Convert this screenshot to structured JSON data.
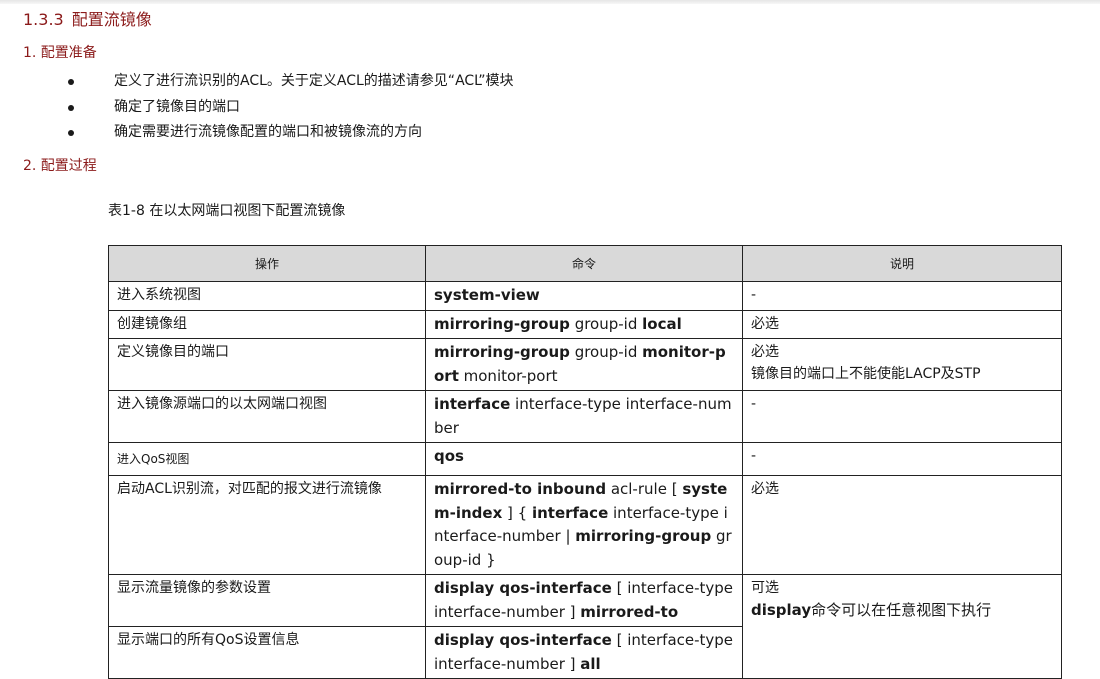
{
  "section": {
    "number": "1.3.3",
    "title": "配置流镜像"
  },
  "prep": {
    "heading": "1. 配置准备",
    "items": [
      "定义了进行流识别的ACL。关于定义ACL的描述请参见“ACL”模块",
      "确定了镜像目的端口",
      "确定需要进行流镜像配置的端口和被镜像流的方向"
    ]
  },
  "process": {
    "heading": "2. 配置过程"
  },
  "table": {
    "caption": "表1-8 在以太网端口视图下配置流镜像",
    "headers": [
      "操作",
      "命令",
      "说明"
    ],
    "rows": [
      {
        "op": "进入系统视图",
        "cmd": [
          {
            "t": "system-view",
            "b": true
          }
        ],
        "note": [
          [
            {
              "t": "-"
            }
          ]
        ]
      },
      {
        "op": "创建镜像组",
        "cmd": [
          {
            "t": "mirroring-group",
            "b": true
          },
          {
            "t": " group-id "
          },
          {
            "t": "local",
            "b": true
          }
        ],
        "note": [
          [
            {
              "t": "必选"
            }
          ]
        ]
      },
      {
        "op": "定义镜像目的端口",
        "cmd": [
          {
            "t": "mirroring-group",
            "b": true
          },
          {
            "t": " group-id "
          },
          {
            "t": "monitor-port",
            "b": true
          },
          {
            "t": " monitor-port"
          }
        ],
        "note": [
          [
            {
              "t": "必选"
            }
          ],
          [
            {
              "t": "镜像目的端口上不能使能LACP及STP"
            }
          ]
        ]
      },
      {
        "op": "进入镜像源端口的以太网端口视图",
        "cmd": [
          {
            "t": "interface",
            "b": true
          },
          {
            "t": " interface-type interface-number"
          }
        ],
        "note": [
          [
            {
              "t": "-"
            }
          ]
        ]
      },
      {
        "op": "进入QoS视图",
        "cmd": [
          {
            "t": "qos",
            "b": true
          }
        ],
        "note": [
          [
            {
              "t": "-"
            }
          ]
        ]
      },
      {
        "op": "启动ACL识别流，对匹配的报文进行流镜像",
        "cmd": [
          {
            "t": "mirrored-to inbound",
            "b": true
          },
          {
            "t": " acl-rule [ "
          },
          {
            "t": "system-index",
            "b": true
          },
          {
            "t": " ] { "
          },
          {
            "t": "interface",
            "b": true
          },
          {
            "t": " interface-type interface-number | "
          },
          {
            "t": "mirroring-group",
            "b": true
          },
          {
            "t": " group-id }"
          }
        ],
        "note": [
          [
            {
              "t": "必选"
            }
          ]
        ]
      },
      {
        "op": "显示流量镜像的参数设置",
        "cmd": [
          {
            "t": "display qos-interface",
            "b": true
          },
          {
            "t": " [ interface-type interface-number ] "
          },
          {
            "t": "mirrored-to",
            "b": true
          }
        ],
        "note": [
          [
            {
              "t": "可选"
            }
          ],
          [
            {
              "t": "display",
              "b": true
            },
            {
              "t": "命令可以在任意视图下执行"
            }
          ]
        ]
      },
      {
        "op": "显示端口的所有QoS设置信息",
        "cmd": [
          {
            "t": "display qos-interface",
            "b": true
          },
          {
            "t": " [ interface-type interface-number ] "
          },
          {
            "t": "all",
            "b": true
          }
        ],
        "note": []
      }
    ]
  }
}
